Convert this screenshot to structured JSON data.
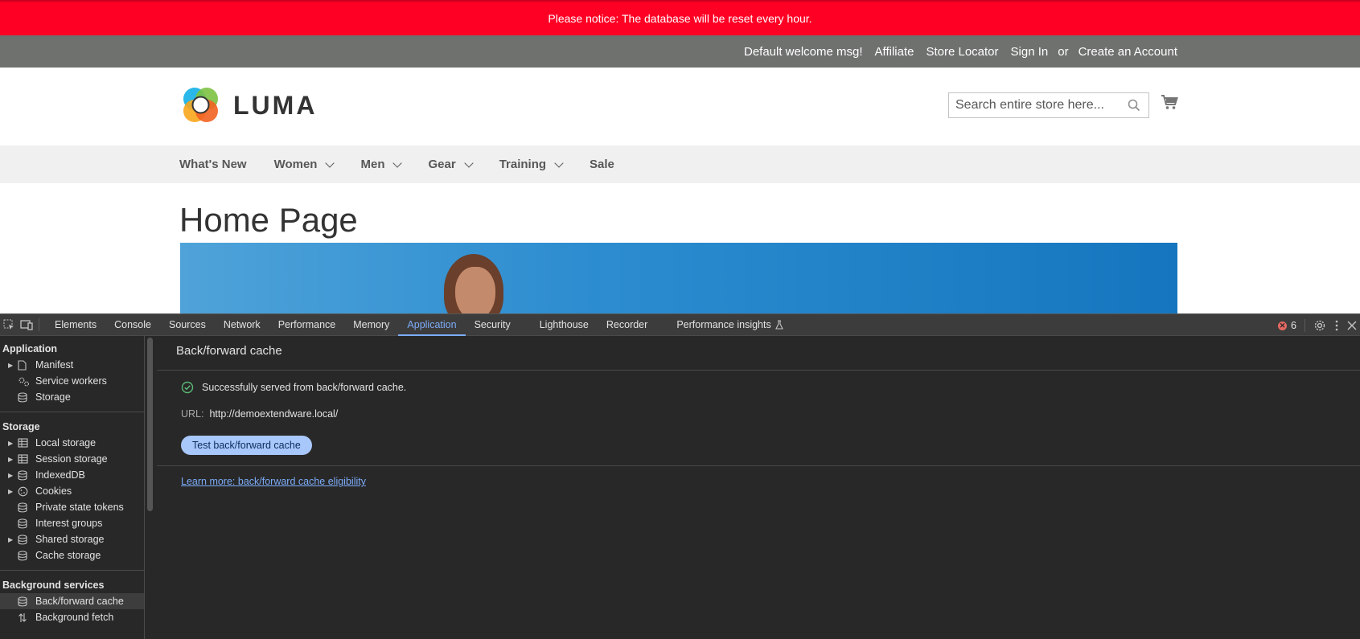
{
  "store": {
    "notice": "Please notice: The database will be reset every hour.",
    "top_links": {
      "welcome": "Default welcome msg!",
      "affiliate": "Affiliate",
      "store_locator": "Store Locator",
      "sign_in": "Sign In",
      "or": "or",
      "create_account": "Create an Account"
    },
    "logo_text": "LUMA",
    "search_placeholder": "Search entire store here...",
    "nav": [
      "What's New",
      "Women",
      "Men",
      "Gear",
      "Training",
      "Sale"
    ],
    "page_title": "Home Page"
  },
  "devtools": {
    "tabs": [
      "Elements",
      "Console",
      "Sources",
      "Network",
      "Performance",
      "Memory",
      "Application",
      "Security",
      "Lighthouse",
      "Recorder",
      "Performance insights"
    ],
    "active_tab": "Application",
    "error_count": "6",
    "sidebar": {
      "application_header": "Application",
      "application_items": [
        "Manifest",
        "Service workers",
        "Storage"
      ],
      "storage_header": "Storage",
      "storage_items": [
        "Local storage",
        "Session storage",
        "IndexedDB",
        "Cookies",
        "Private state tokens",
        "Interest groups",
        "Shared storage",
        "Cache storage"
      ],
      "background_header": "Background services",
      "background_items": [
        "Back/forward cache",
        "Background fetch"
      ]
    },
    "panel": {
      "title": "Back/forward cache",
      "status": "Successfully served from back/forward cache.",
      "url_label": "URL:",
      "url_value": "http://demoextendware.local/",
      "test_button": "Test back/forward cache",
      "learn_more": "Learn more: back/forward cache eligibility"
    }
  },
  "colors": {
    "notice_bg": "#ff0025",
    "topbar_bg": "#6e716e",
    "nav_bg": "#f0f0f0",
    "devtools_bg": "#282828",
    "accent_blue": "#7cacf8",
    "success_green": "#5bb974"
  }
}
